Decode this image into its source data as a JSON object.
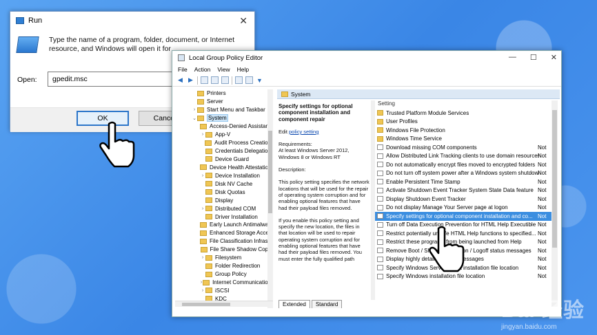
{
  "run": {
    "title": "Run",
    "close": "✕",
    "description": "Type the name of a program, folder, document, or Internet resource, and Windows will open it for",
    "open_label": "Open:",
    "open_value": "gpedit.msc",
    "ok": "OK",
    "cancel": "Cancel"
  },
  "gp": {
    "title": "Local Group Policy Editor",
    "controls": {
      "min": "—",
      "max": "☐",
      "close": "✕"
    },
    "menu": [
      "File",
      "Action",
      "View",
      "Help"
    ],
    "tree": [
      {
        "label": "Printers",
        "level": 1,
        "exp": ""
      },
      {
        "label": "Server",
        "level": 1,
        "exp": ""
      },
      {
        "label": "Start Menu and Taskbar",
        "level": 1,
        "exp": "›"
      },
      {
        "label": "System",
        "level": 1,
        "exp": "⌄",
        "sel": true
      },
      {
        "label": "Access-Denied Assistance",
        "level": 2,
        "exp": ""
      },
      {
        "label": "App-V",
        "level": 2,
        "exp": "›"
      },
      {
        "label": "Audit Process Creation",
        "level": 2,
        "exp": ""
      },
      {
        "label": "Credentials Delegation",
        "level": 2,
        "exp": ""
      },
      {
        "label": "Device Guard",
        "level": 2,
        "exp": ""
      },
      {
        "label": "Device Health Attestation",
        "level": 2,
        "exp": ""
      },
      {
        "label": "Device Installation",
        "level": 2,
        "exp": "›"
      },
      {
        "label": "Disk NV Cache",
        "level": 2,
        "exp": ""
      },
      {
        "label": "Disk Quotas",
        "level": 2,
        "exp": ""
      },
      {
        "label": "Display",
        "level": 2,
        "exp": ""
      },
      {
        "label": "Distributed COM",
        "level": 2,
        "exp": "›"
      },
      {
        "label": "Driver Installation",
        "level": 2,
        "exp": ""
      },
      {
        "label": "Early Launch Antimalware",
        "level": 2,
        "exp": ""
      },
      {
        "label": "Enhanced Storage Access",
        "level": 2,
        "exp": ""
      },
      {
        "label": "File Classification Infrastructure",
        "level": 2,
        "exp": ""
      },
      {
        "label": "File Share Shadow Copy",
        "level": 2,
        "exp": ""
      },
      {
        "label": "Filesystem",
        "level": 2,
        "exp": "›"
      },
      {
        "label": "Folder Redirection",
        "level": 2,
        "exp": ""
      },
      {
        "label": "Group Policy",
        "level": 2,
        "exp": ""
      },
      {
        "label": "Internet Communication",
        "level": 2,
        "exp": "›"
      },
      {
        "label": "iSCSI",
        "level": 2,
        "exp": "›"
      },
      {
        "label": "KDC",
        "level": 2,
        "exp": ""
      }
    ],
    "right_header": "System",
    "desc": {
      "title": "Specify settings for optional component installation and component repair",
      "edit_prefix": "Edit ",
      "edit_link": "policy setting",
      "requirements": "Requirements:\nAt least Windows Server 2012, Windows 8 or Windows RT",
      "description_label": "Description:",
      "p1": "This policy setting specifies the network locations that will be used for the repair of operating system corruption and for enabling optional features that have had their payload files removed.",
      "p2": "If you enable this policy setting and specify the new location, the files in that location will be used to repair operating system corruption and for enabling optional features that have had their payload files removed. You must enter the fully qualified path"
    },
    "list_header": "Setting",
    "settings": [
      {
        "name": "Trusted Platform Module Services",
        "folder": true,
        "state": ""
      },
      {
        "name": "User Profiles",
        "folder": true,
        "state": ""
      },
      {
        "name": "Windows File Protection",
        "folder": true,
        "state": ""
      },
      {
        "name": "Windows Time Service",
        "folder": true,
        "state": ""
      },
      {
        "name": "Download missing COM components",
        "folder": false,
        "state": "Not"
      },
      {
        "name": "Allow Distributed Link Tracking clients to use domain resources",
        "folder": false,
        "state": "Not"
      },
      {
        "name": "Do not automatically encrypt files moved to encrypted folders",
        "folder": false,
        "state": "Not"
      },
      {
        "name": "Do not turn off system power after a Windows system shutdown",
        "folder": false,
        "state": "Not"
      },
      {
        "name": "Enable Persistent Time Stamp",
        "folder": false,
        "state": "Not"
      },
      {
        "name": "Activate Shutdown Event Tracker System State Data feature",
        "folder": false,
        "state": "Not"
      },
      {
        "name": "Display Shutdown Event Tracker",
        "folder": false,
        "state": "Not"
      },
      {
        "name": "Do not display Manage Your Server page at logon",
        "folder": false,
        "state": "Not"
      },
      {
        "name": "Specify settings for optional component installation and co...",
        "folder": false,
        "state": "Not",
        "sel": true
      },
      {
        "name": "Turn off Data Execution Prevention for HTML Help Executible",
        "folder": false,
        "state": "Not"
      },
      {
        "name": "Restrict potentially unsafe HTML Help functions to specified...",
        "folder": false,
        "state": "Not"
      },
      {
        "name": "Restrict these programs from being launched from Help",
        "folder": false,
        "state": "Not"
      },
      {
        "name": "Remove Boot / Shutdown / Logon / Logoff status messages",
        "folder": false,
        "state": "Not"
      },
      {
        "name": "Display highly detailed status messages",
        "folder": false,
        "state": "Not"
      },
      {
        "name": "Specify Windows Service Pack installation file location",
        "folder": false,
        "state": "Not"
      },
      {
        "name": "Specify Windows installation file location",
        "folder": false,
        "state": "Not"
      }
    ],
    "tabs": [
      "Extended",
      "Standard"
    ]
  },
  "watermark": {
    "brand": "Bai 经验",
    "url": "jingyan.baidu.com"
  }
}
